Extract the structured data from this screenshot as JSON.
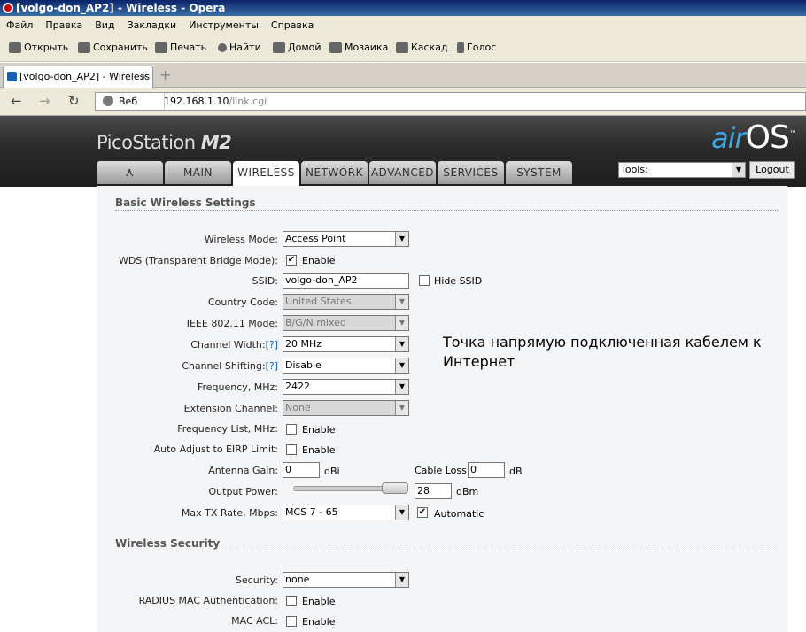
{
  "window": {
    "title": "[volgo-don_AP2] - Wireless - Opera"
  },
  "menu": [
    "Файл",
    "Правка",
    "Вид",
    "Закладки",
    "Инструменты",
    "Справка"
  ],
  "toolbar": {
    "open": "Открыть",
    "save": "Сохранить",
    "print": "Печать",
    "find": "Найти",
    "home": "Домой",
    "mosaic": "Мозаика",
    "cascade": "Каскад",
    "voice": "Голос"
  },
  "tab": {
    "title": "[volgo-don_AP2] - Wireless",
    "close": "×",
    "new": "+"
  },
  "address": {
    "web_label": "Веб",
    "url_host": "192.168.1.10",
    "url_path": "/link.cgi"
  },
  "device": {
    "product": "PicoStation",
    "model": "M2",
    "logo_air": "air",
    "logo_os": "OS",
    "logo_tm": "™"
  },
  "nav_tabs": [
    "MAIN",
    "WIRELESS",
    "NETWORK",
    "ADVANCED",
    "SERVICES",
    "SYSTEM"
  ],
  "tools": {
    "label": "Tools:",
    "logout": "Logout"
  },
  "basic": {
    "title": "Basic Wireless Settings",
    "wireless_mode_label": "Wireless Mode:",
    "wireless_mode": "Access Point",
    "wds_label": "WDS (Transparent Bridge Mode):",
    "wds_enable": "Enable",
    "ssid_label": "SSID:",
    "ssid": "volgo-don_AP2",
    "hide_ssid": "Hide SSID",
    "country_label": "Country Code:",
    "country": "United States",
    "ieee_label": "IEEE 802.11 Mode:",
    "ieee": "B/G/N mixed",
    "channel_width_label": "Channel Width:",
    "channel_width": "20 MHz",
    "channel_shift_label": "Channel Shifting:",
    "channel_shift": "Disable",
    "help": "[?]",
    "freq_label": "Frequency, MHz:",
    "freq": "2422",
    "ext_label": "Extension Channel:",
    "ext": "None",
    "freq_list_label": "Frequency List, MHz:",
    "freq_list_enable": "Enable",
    "eirp_label": "Auto Adjust to EIRP Limit:",
    "eirp_enable": "Enable",
    "antenna_label": "Antenna Gain:",
    "antenna": "0",
    "antenna_unit": "dBi",
    "cable_label": "Cable Loss:",
    "cable": "0",
    "cable_unit": "dB",
    "power_label": "Output Power:",
    "power": "28",
    "power_unit": "dBm",
    "txrate_label": "Max TX Rate, Mbps:",
    "txrate": "MCS 7 - 65",
    "automatic": "Automatic"
  },
  "note": "Точка напрямую подключенная кабелем к Интернет",
  "security": {
    "title": "Wireless Security",
    "security_label": "Security:",
    "security": "none",
    "radius_label": "RADIUS MAC Authentication:",
    "radius_enable": "Enable",
    "acl_label": "MAC ACL:",
    "acl_enable": "Enable"
  }
}
